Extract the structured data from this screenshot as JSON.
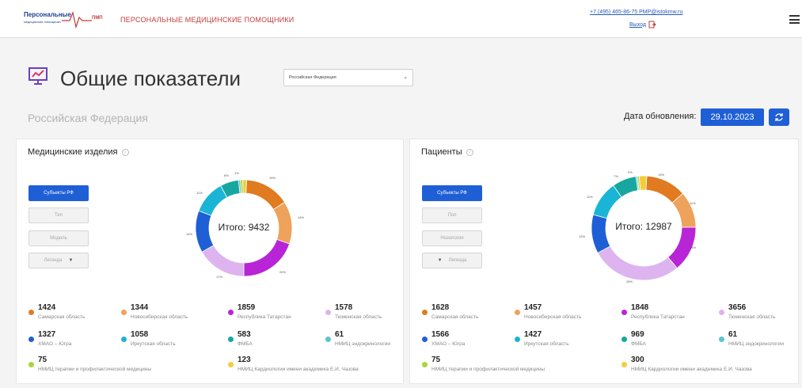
{
  "header": {
    "logo_main": "Персональные",
    "logo_sub": "медицинские помощники",
    "logo_suffix": "ПМП",
    "brand": "ПЕРСОНАЛЬНЫЕ МЕДИЦИНСКИЕ ПОМОЩНИКИ",
    "contact": "+7 (495) 465-86-75 PMP@istokmw.ru",
    "logout": "Выход"
  },
  "page": {
    "title": "Общие показатели",
    "region_selected": "Российская Федерация",
    "subtitle": "Российская Федерация",
    "update_label": "Дата обновления:",
    "update_date": "29.10.2023"
  },
  "colors": {
    "primary": "#1f5fd6",
    "samara": "#e07b1f",
    "novosibirsk": "#eea25b",
    "tatarstan": "#b825d6",
    "tyumen": "#ddb4ef",
    "hmao": "#1f5fd6",
    "irkutsk": "#1ab5d6",
    "fmba": "#17a7a0",
    "endocrin": "#5bc4d0",
    "therapy": "#a6d63a",
    "cardio": "#f4cd3c"
  },
  "cards": [
    {
      "title": "Медицинские изделия",
      "buttons": [
        "Субъекты РФ",
        "Тип",
        "Модель",
        "Легенда"
      ],
      "total_label": "Итого: 9432",
      "chart_data": {
        "type": "pie",
        "title": "Медицинские изделия",
        "total": 9432,
        "categories": [
          "Самарская область",
          "Новосибирская область",
          "Республика Татарстан",
          "Тюменская область",
          "ХМАО – Югра",
          "Иркутская область",
          "ФМБА",
          "НМИЦ эндокринологии",
          "НМИЦ терапии и профилактической медицины",
          "НМИЦ Кардиологии имени академика Е.И. Чазова"
        ],
        "values": [
          1424,
          1344,
          1859,
          1578,
          1327,
          1058,
          583,
          61,
          75,
          123
        ],
        "percent_labels": [
          "15%",
          "14%",
          "20%",
          "17%",
          "14%",
          "11%",
          "6%",
          "1%"
        ]
      },
      "legend": [
        {
          "value": "1424",
          "name": "Самарская область",
          "color": "#e07b1f"
        },
        {
          "value": "1344",
          "name": "Новосибирская область",
          "color": "#eea25b"
        },
        {
          "value": "1859",
          "name": "Республика Татарстан",
          "color": "#b825d6"
        },
        {
          "value": "1578",
          "name": "Тюменская область",
          "color": "#ddb4ef"
        },
        {
          "value": "1327",
          "name": "ХМАО – Югра",
          "color": "#1f5fd6"
        },
        {
          "value": "1058",
          "name": "Иркутская область",
          "color": "#1ab5d6"
        },
        {
          "value": "583",
          "name": "ФМБА",
          "color": "#17a7a0"
        },
        {
          "value": "61",
          "name": "НМИЦ эндокринологии",
          "color": "#5bc4d0"
        },
        {
          "value": "75",
          "name": "НМИЦ терапии и профилактической медицины",
          "color": "#a6d63a"
        },
        {
          "value": "123",
          "name": "НМИЦ Кардиологии имени академика Е.И. Чазова",
          "color": "#f4cd3c"
        }
      ]
    },
    {
      "title": "Пациенты",
      "buttons": [
        "Субъекты РФ",
        "Пол",
        "Нозология",
        "Легенда"
      ],
      "total_label": "Итого: 12987",
      "chart_data": {
        "type": "pie",
        "title": "Пациенты",
        "total": 12987,
        "categories": [
          "Самарская область",
          "Новосибирская область",
          "Республика Татарстан",
          "Тюменская область",
          "ХМАО – Югра",
          "Иркутская область",
          "ФМБА",
          "НМИЦ эндокринологии",
          "НМИЦ терапии и профилактической медицины",
          "НМИЦ Кардиологии имени академика Е.И. Чазова"
        ],
        "values": [
          1628,
          1457,
          1848,
          3656,
          1566,
          1427,
          969,
          61,
          75,
          300
        ],
        "percent_labels": [
          "13%",
          "11%",
          "14%",
          "28%",
          "12%",
          "11%",
          "7%",
          "0%"
        ]
      },
      "legend": [
        {
          "value": "1628",
          "name": "Самарская область",
          "color": "#e07b1f"
        },
        {
          "value": "1457",
          "name": "Новосибирская область",
          "color": "#eea25b"
        },
        {
          "value": "1848",
          "name": "Республика Татарстан",
          "color": "#b825d6"
        },
        {
          "value": "3656",
          "name": "Тюменская область",
          "color": "#ddb4ef"
        },
        {
          "value": "1566",
          "name": "ХМАО – Югра",
          "color": "#1f5fd6"
        },
        {
          "value": "1427",
          "name": "Иркутская область",
          "color": "#1ab5d6"
        },
        {
          "value": "969",
          "name": "ФМБА",
          "color": "#17a7a0"
        },
        {
          "value": "61",
          "name": "НМИЦ эндокринологии",
          "color": "#5bc4d0"
        },
        {
          "value": "75",
          "name": "НМИЦ терапии и профилактической медицины",
          "color": "#a6d63a"
        },
        {
          "value": "300",
          "name": "НМИЦ Кардиологии имени академика Е.И. Чазова",
          "color": "#f4cd3c"
        }
      ]
    }
  ]
}
